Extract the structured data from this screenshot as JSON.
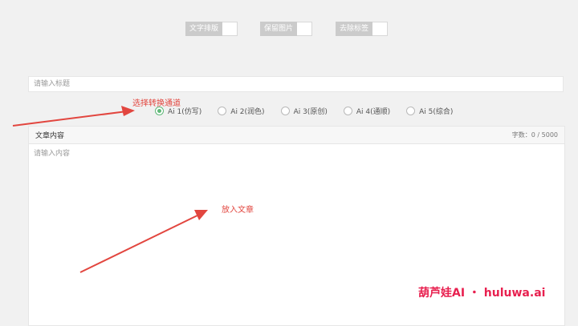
{
  "toggles": [
    {
      "label": "文字排版"
    },
    {
      "label": "保留图片"
    },
    {
      "label": "去除标签"
    }
  ],
  "title_input": {
    "placeholder": "请输入标题",
    "value": ""
  },
  "channels": {
    "selected_index": 0,
    "options": [
      {
        "label": "Ai 1(仿写)"
      },
      {
        "label": "Ai 2(润色)"
      },
      {
        "label": "Ai 3(原创)"
      },
      {
        "label": "Ai 4(通顺)"
      },
      {
        "label": "Ai 5(综合)"
      }
    ]
  },
  "editor": {
    "title": "文章内容",
    "count": "字数：0 / 5000",
    "placeholder": "请输入内容",
    "value": ""
  },
  "annotations": {
    "select_channel": "选择转换通道",
    "put_article": "放入文章"
  },
  "watermark": {
    "text": "葫芦娃AI ・ huluwa.ai",
    "color": "#e8204f"
  },
  "colors": {
    "accent": "#5fb878",
    "annotation": "#e2463f"
  }
}
